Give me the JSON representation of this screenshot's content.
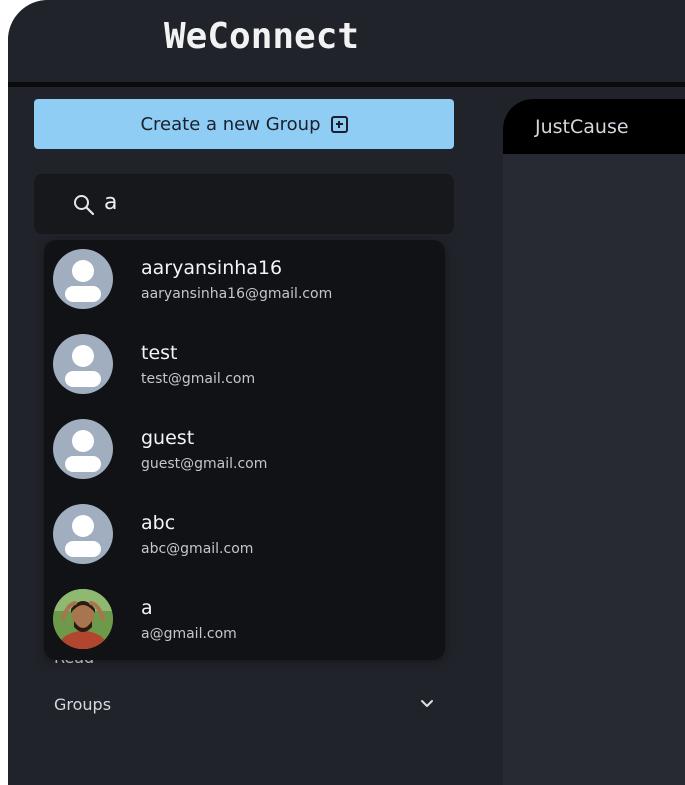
{
  "app": {
    "title": "WeConnect"
  },
  "sidebar": {
    "create_group_label": "Create a new Group",
    "search": {
      "value": "a"
    },
    "sections": [
      {
        "label": "Read"
      },
      {
        "label": "Groups"
      }
    ]
  },
  "search_results": [
    {
      "name": "aaryansinha16",
      "email": "aaryansinha16@gmail.com",
      "avatar": "default-avatar"
    },
    {
      "name": "test",
      "email": "test@gmail.com",
      "avatar": "default-avatar"
    },
    {
      "name": "guest",
      "email": "guest@gmail.com",
      "avatar": "default-avatar"
    },
    {
      "name": "abc",
      "email": "abc@gmail.com",
      "avatar": "default-avatar"
    },
    {
      "name": "a",
      "email": "a@gmail.com",
      "avatar": "photo-avatar"
    }
  ],
  "chat": {
    "title": "JustCause"
  },
  "colors": {
    "background": "#21232a",
    "accent_button": "#90cdf4",
    "dropdown": "#111216",
    "avatar_default": "#a0aec0",
    "online_dot": "#22a05a"
  }
}
